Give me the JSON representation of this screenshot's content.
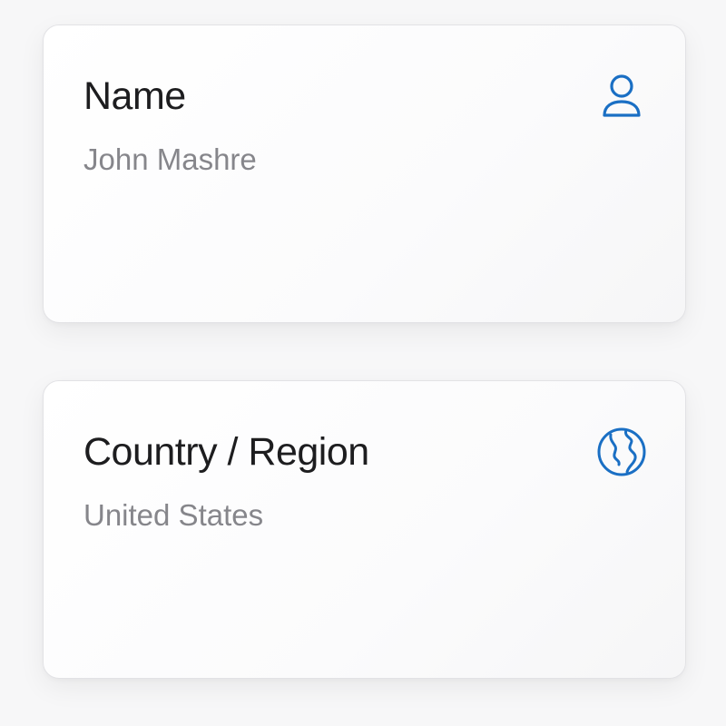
{
  "cards": [
    {
      "title": "Name",
      "value": "John Mashre",
      "icon": "person-icon"
    },
    {
      "title": "Country / Region",
      "value": "United States",
      "icon": "globe-icon"
    }
  ],
  "colors": {
    "accent": "#1a6fc4",
    "title_text": "#1d1d1f",
    "value_text": "#86868b",
    "background": "#f7f7f8",
    "card_border": "#e2e2e5"
  }
}
